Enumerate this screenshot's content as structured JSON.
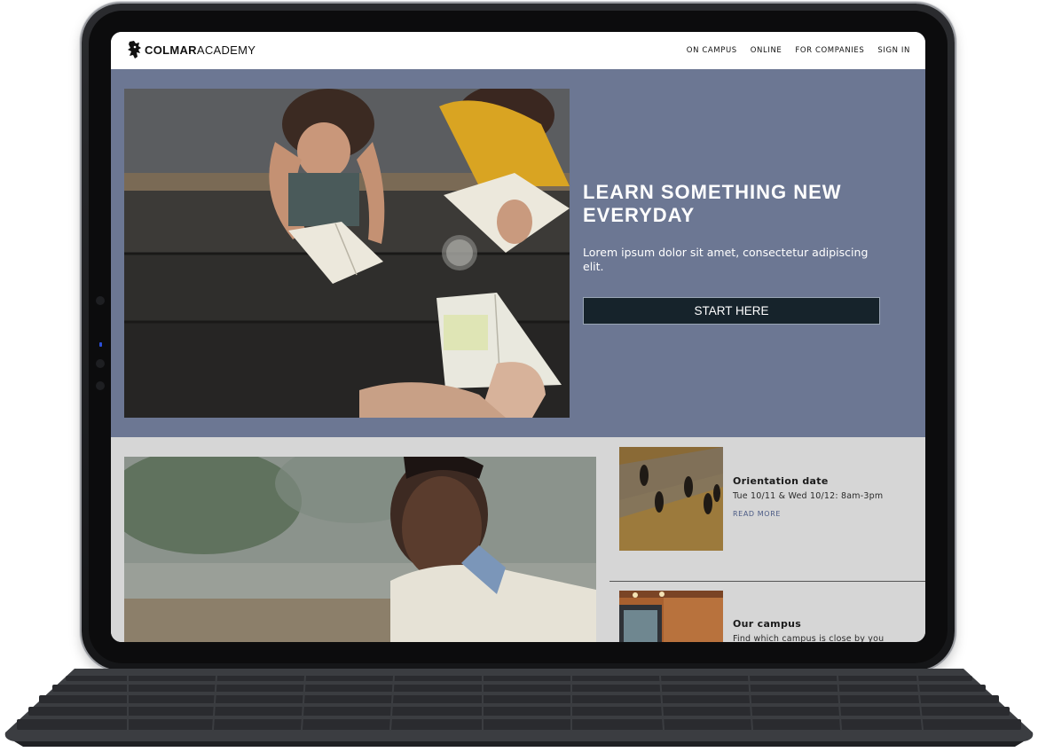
{
  "header": {
    "brand_bold": "COLMAR",
    "brand_light": "ACADEMY",
    "logo_icon": "lion-crest-icon",
    "nav": [
      "ON CAMPUS",
      "ONLINE",
      "FOR COMPANIES",
      "SIGN IN"
    ]
  },
  "hero": {
    "title": "LEARN SOMETHING NEW EVERYDAY",
    "subtitle": "Lorem ipsum dolor sit amet, consectetur adipiscing elit.",
    "cta_label": "START HERE"
  },
  "news": [
    {
      "title": "Orientation date",
      "text": "Tue 10/11 & Wed 10/12: 8am-3pm",
      "link": "READ MORE"
    },
    {
      "title": "Our campus",
      "text": "Find which campus is close by you"
    }
  ],
  "colors": {
    "hero_bg": "#6c7793",
    "lower_bg": "#d6d6d6",
    "cta_bg": "#16232b",
    "link": "#4a5a85"
  }
}
